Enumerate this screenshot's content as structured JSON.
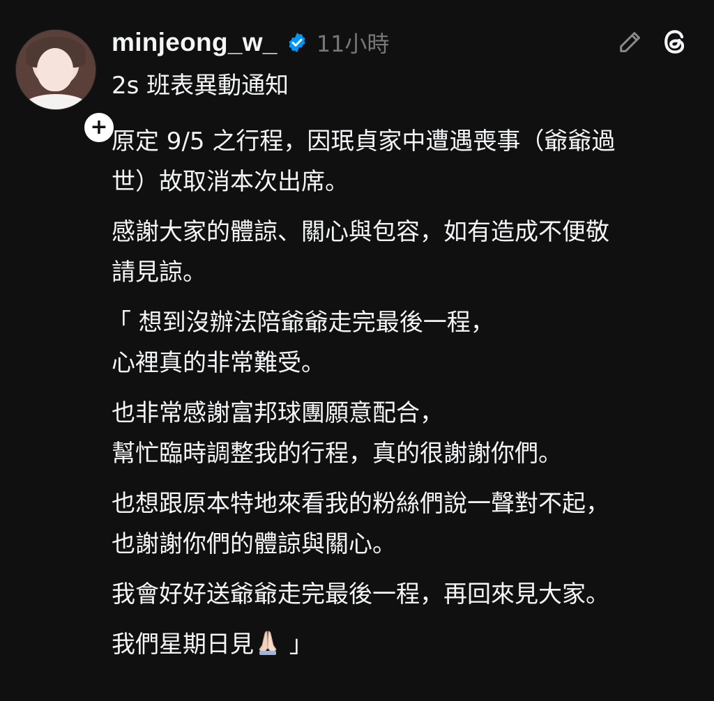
{
  "post": {
    "username": "minjeong_w_",
    "time": "11小時",
    "subtitle": "2s 班表異動通知",
    "follow_symbol": "+",
    "verified_icon": "verified-badge-icon",
    "colors": {
      "background": "#101010",
      "text": "#f3f5f7",
      "muted": "#777777",
      "verified": "#0095f6"
    },
    "paragraphs": [
      [
        "原定 9/5 之行程，因珉貞家中遭遇喪事（爺爺過",
        "世）故取消本次出席。"
      ],
      [
        "感謝大家的體諒、關心與包容，如有造成不便敬",
        "請見諒。"
      ],
      [
        "「 想到沒辦法陪爺爺走完最後一程，",
        "心裡真的非常難受。"
      ],
      [
        "也非常感謝富邦球團願意配合，",
        "幫忙臨時調整我的行程，真的很謝謝你們。"
      ],
      [
        "也想跟原本特地來看我的粉絲們說一聲對不起，",
        "也謝謝你們的體諒與關心。"
      ],
      [
        "我會好好送爺爺走完最後一程，再回來見大家。"
      ],
      [
        "我們星期日見"
      ]
    ],
    "closing_quote": " 」",
    "emoji": "folded-hands-emoji"
  },
  "icons": {
    "edit": "pencil-icon",
    "app": "threads-logo-icon"
  }
}
